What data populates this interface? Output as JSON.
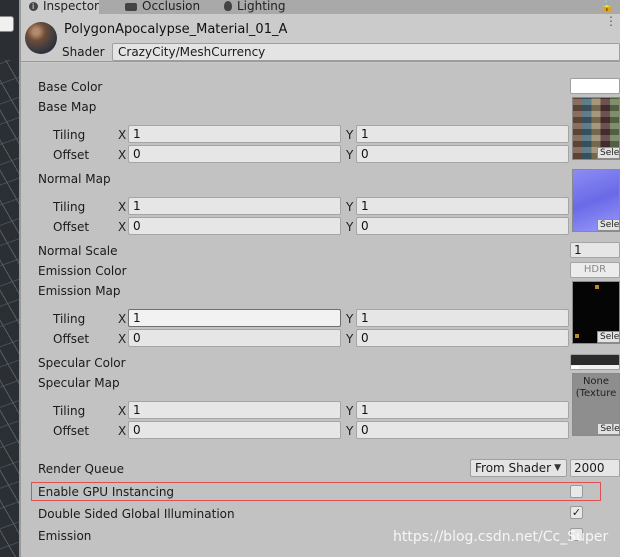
{
  "tabs": [
    {
      "label": "Inspector",
      "icon": "info-icon",
      "active": true
    },
    {
      "label": "Occlusion",
      "icon": "camera-icon",
      "active": false
    },
    {
      "label": "Lighting",
      "icon": "bulb-icon",
      "active": false
    }
  ],
  "header": {
    "material_name": "PolygonApocalypse_Material_01_A",
    "shader_label": "Shader",
    "shader_value": "CrazyCity/MeshCurrency"
  },
  "props": {
    "base_color": "Base Color",
    "base_map": "Base Map",
    "normal_map": "Normal Map",
    "normal_scale": "Normal Scale",
    "normal_scale_value": "1",
    "emission_color": "Emission Color",
    "emission_hdr": "HDR",
    "emission_map": "Emission Map",
    "specular_color": "Specular Color",
    "specular_map": "Specular Map",
    "specular_none": "None",
    "specular_none_sub": "(Texture",
    "render_queue": "Render Queue",
    "render_queue_mode": "From Shader",
    "render_queue_value": "2000",
    "gpu_instancing": "Enable GPU Instancing",
    "double_sided_gi": "Double Sided Global Illumination",
    "emission": "Emission"
  },
  "common": {
    "tiling": "Tiling",
    "offset": "Offset",
    "x": "X",
    "y": "Y",
    "select": "Sele"
  },
  "texture_blocks": {
    "base": {
      "tiling_x": "1",
      "tiling_y": "1",
      "offset_x": "0",
      "offset_y": "0"
    },
    "normal": {
      "tiling_x": "1",
      "tiling_y": "1",
      "offset_x": "0",
      "offset_y": "0"
    },
    "emission": {
      "tiling_x": "1",
      "tiling_y": "1",
      "offset_x": "0",
      "offset_y": "0"
    },
    "specular": {
      "tiling_x": "1",
      "tiling_y": "1",
      "offset_x": "0",
      "offset_y": "0"
    }
  },
  "checkboxes": {
    "gpu_instancing": false,
    "double_sided_gi": true,
    "double_sided_gi_mark": "✓",
    "emission": false
  },
  "colors": {
    "highlight": "#e05050",
    "base_color_swatch": "#ffffff"
  },
  "watermark": "https://blog.csdn.net/Cc_Super"
}
